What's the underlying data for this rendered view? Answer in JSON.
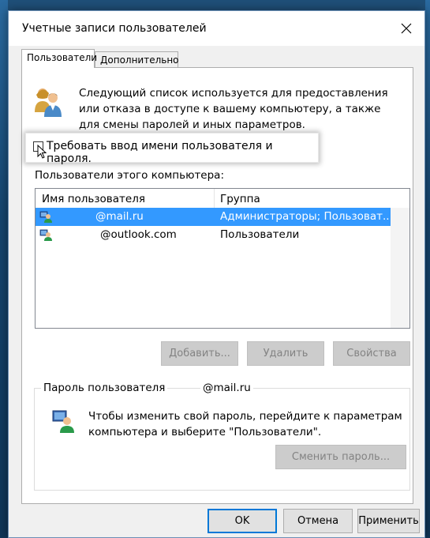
{
  "window": {
    "title": "Учетные записи пользователей"
  },
  "tabs": [
    {
      "label": "Пользователи",
      "active": true
    },
    {
      "label": "Дополнительно",
      "active": false
    }
  ],
  "intro_text": "Следующий список используется для предоставления или отказа в доступе к вашему компьютеру, а также для смены паролей и иных параметров.",
  "checkbox": {
    "label": "Требовать ввод имени пользователя и пароля.",
    "checked": false
  },
  "users_list": {
    "label": "Пользователи этого компьютера:",
    "columns": [
      "Имя пользователя",
      "Группа"
    ],
    "rows": [
      {
        "name": "@mail.ru",
        "group": "Администраторы; Пользоват...",
        "selected": true
      },
      {
        "name": "@outlook.com",
        "group": "Пользователи",
        "selected": false
      }
    ]
  },
  "list_buttons": {
    "add": "Добавить...",
    "remove": "Удалить",
    "properties": "Свойства"
  },
  "password_group": {
    "legend": "Пароль пользователя",
    "user": "@mail.ru",
    "text": "Чтобы изменить свой пароль, перейдите к параметрам компьютера и выберите \"Пользователи\".",
    "change_button": "Сменить пароль..."
  },
  "footer": {
    "ok": "OK",
    "cancel": "Отмена",
    "apply": "Применить"
  },
  "colors": {
    "selection": "#3399ff",
    "default_button_border": "#0078d7"
  }
}
